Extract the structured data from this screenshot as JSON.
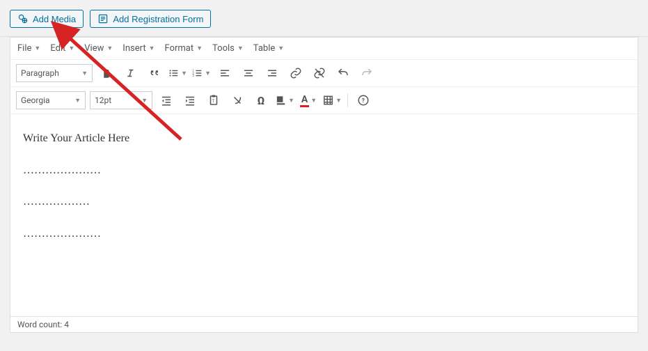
{
  "topbar": {
    "add_media": "Add Media",
    "add_registration": "Add Registration Form"
  },
  "menu": {
    "file": "File",
    "edit": "Edit",
    "view": "View",
    "insert": "Insert",
    "format": "Format",
    "tools": "Tools",
    "table": "Table"
  },
  "toolbar": {
    "format_select": "Paragraph",
    "font_family": "Georgia",
    "font_size": "12pt"
  },
  "content": {
    "line1": "Write Your Article Here",
    "dots1": "…………………",
    "dots2": "………………",
    "dots3": "…………………"
  },
  "status": {
    "word_count_label": "Word count:",
    "word_count_value": "4"
  },
  "icons": {
    "media": "media-icon",
    "form": "form-icon"
  },
  "annotation": {
    "arrow_color": "#d62424"
  }
}
